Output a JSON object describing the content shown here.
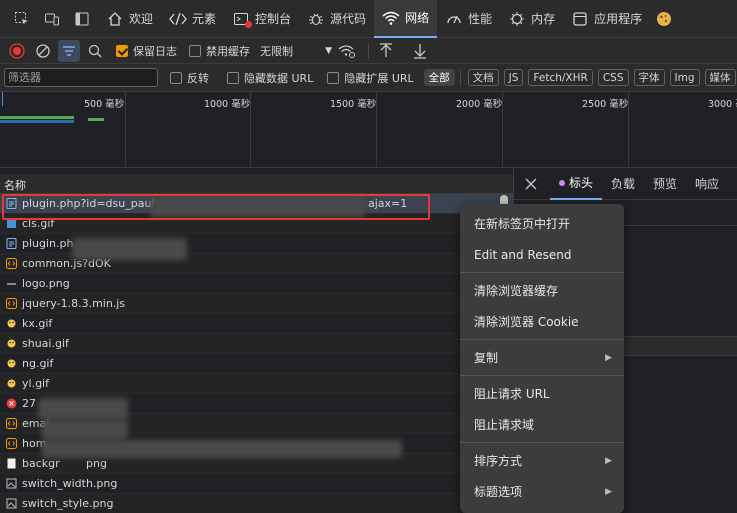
{
  "tabs": [
    {
      "label": "欢迎",
      "icon": "home-icon"
    },
    {
      "label": "元素",
      "icon": "code-icon"
    },
    {
      "label": "控制台",
      "icon": "console-icon"
    },
    {
      "label": "源代码",
      "icon": "bug-icon"
    },
    {
      "label": "网络",
      "icon": "wifi-icon",
      "active": true
    },
    {
      "label": "性能",
      "icon": "gauge-icon"
    },
    {
      "label": "内存",
      "icon": "chip-icon"
    },
    {
      "label": "应用程序",
      "icon": "app-icon"
    }
  ],
  "toolbar": {
    "preserve_log": "保留日志",
    "disable_cache": "禁用缓存",
    "throttle": "无限制"
  },
  "filter": {
    "placeholder": "筛选器",
    "invert": "反转",
    "hide_data_url": "隐藏数据 URL",
    "hide_ext_url": "隐藏扩展 URL",
    "types": [
      "全部",
      "文档",
      "JS",
      "Fetch/XHR",
      "CSS",
      "字体",
      "Img",
      "媒体"
    ]
  },
  "timeline": {
    "labels": [
      "500 毫秒",
      "1000 毫秒",
      "1500 毫秒",
      "2000 毫秒",
      "2500 毫秒",
      "3000 毫秒"
    ]
  },
  "list": {
    "header": "名称",
    "rows": [
      {
        "name": "plugin.php?id=dsu_paulsi",
        "suffix": "ajax=1",
        "type": "doc"
      },
      {
        "name": "cls.gif",
        "type": "img"
      },
      {
        "name": "plugin.ph",
        "type": "doc"
      },
      {
        "name": "common.js?dOK",
        "type": "js"
      },
      {
        "name": "logo.png",
        "type": "png"
      },
      {
        "name": "jquery-1.8.3.min.js",
        "type": "js"
      },
      {
        "name": "kx.gif",
        "type": "img"
      },
      {
        "name": "shuai.gif",
        "type": "img"
      },
      {
        "name": "ng.gif",
        "type": "img"
      },
      {
        "name": "yl.gif",
        "type": "img"
      },
      {
        "name": "27",
        "type": "error"
      },
      {
        "name": "emai",
        "type": "js"
      },
      {
        "name": "hom",
        "type": "js"
      },
      {
        "name": "backgr",
        "suffix": "png",
        "type": "png"
      },
      {
        "name": "switch_width.png",
        "type": "png"
      },
      {
        "name": "switch_style.png",
        "type": "png"
      }
    ]
  },
  "detail": {
    "tabs": [
      "标头",
      "负载",
      "预览",
      "响应"
    ]
  },
  "context_menu": [
    {
      "label": "在新标签页中打开"
    },
    {
      "label": "Edit and Resend"
    },
    {
      "sep": true
    },
    {
      "label": "清除浏览器缓存"
    },
    {
      "label": "清除浏览器 Cookie"
    },
    {
      "sep": true
    },
    {
      "label": "复制",
      "submenu": true
    },
    {
      "sep": true
    },
    {
      "label": "阻止请求 URL"
    },
    {
      "label": "阻止请求域"
    },
    {
      "sep": true
    },
    {
      "label": "排序方式",
      "submenu": true
    },
    {
      "label": "标题选项",
      "submenu": true
    }
  ]
}
